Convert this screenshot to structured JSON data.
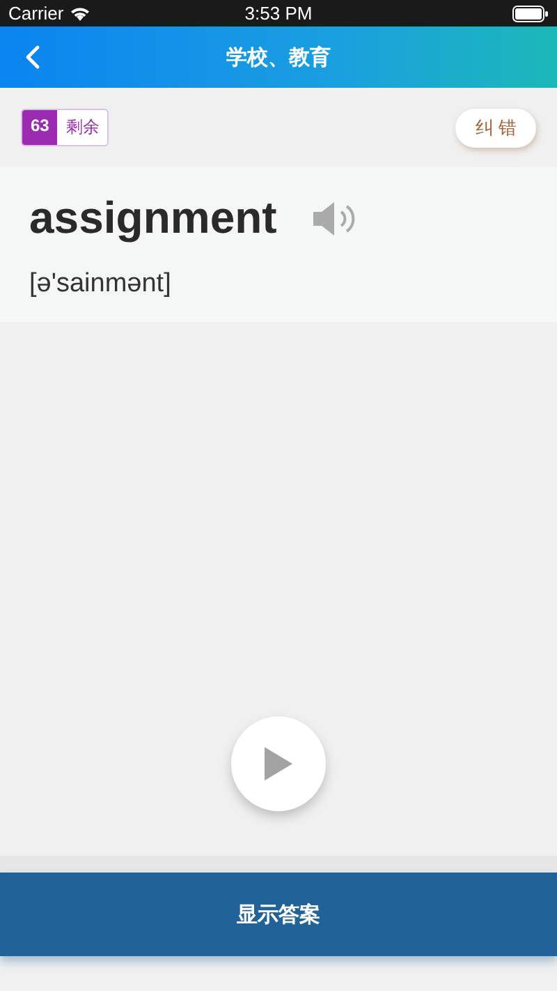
{
  "status_bar": {
    "carrier": "Carrier",
    "time": "3:53 PM"
  },
  "nav": {
    "title": "学校、教育"
  },
  "counter": {
    "count": "63",
    "label": "剩余"
  },
  "report_button": "纠 错",
  "word": {
    "text": "assignment",
    "phonetic": "[ə'sainmənt]"
  },
  "answer_button": "显示答案"
}
